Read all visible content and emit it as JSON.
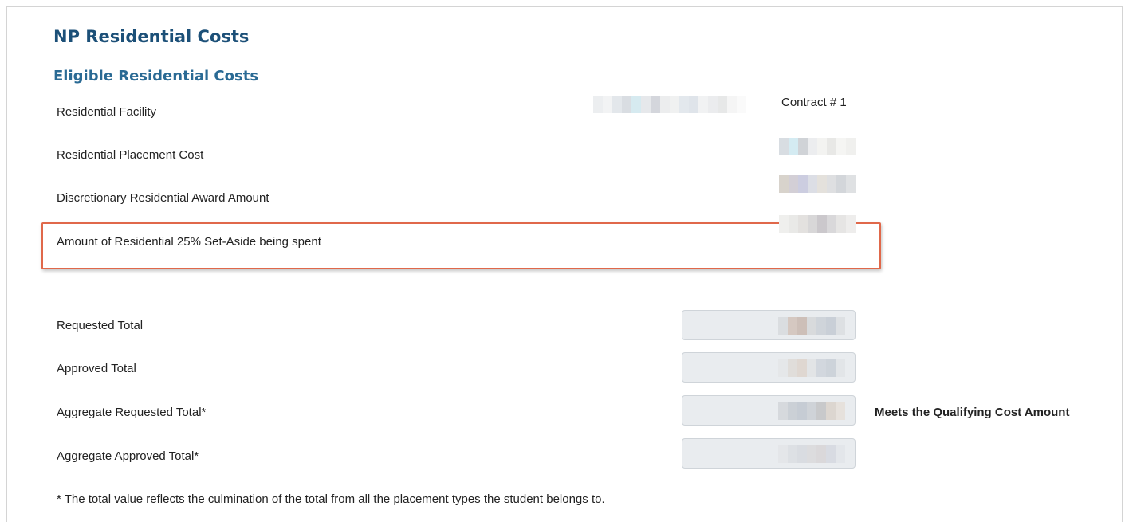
{
  "page": {
    "title": "NP Residential Costs",
    "section_title": "Eligible Residential Costs"
  },
  "residential": {
    "facility_label": "Residential Facility",
    "contract_label": "Contract # 1",
    "placement_cost_label": "Residential Placement Cost",
    "discretionary_award_label": "Discretionary Residential Award Amount",
    "set_aside_label": "Amount of Residential 25% Set-Aside being spent"
  },
  "totals": {
    "requested_total_label": "Requested Total",
    "approved_total_label": "Approved Total",
    "aggregate_requested_label": "Aggregate Requested Total*",
    "aggregate_approved_label": "Aggregate Approved Total*",
    "qualifying_status": "Meets the Qualifying Cost Amount"
  },
  "footnote": "* The total value reflects the culmination of the total from all the placement types the student belongs to.",
  "colors": {
    "title": "#1c5078",
    "subtitle": "#2a6a94",
    "highlight_border": "#e0684a",
    "field_background": "#e9ecef"
  }
}
